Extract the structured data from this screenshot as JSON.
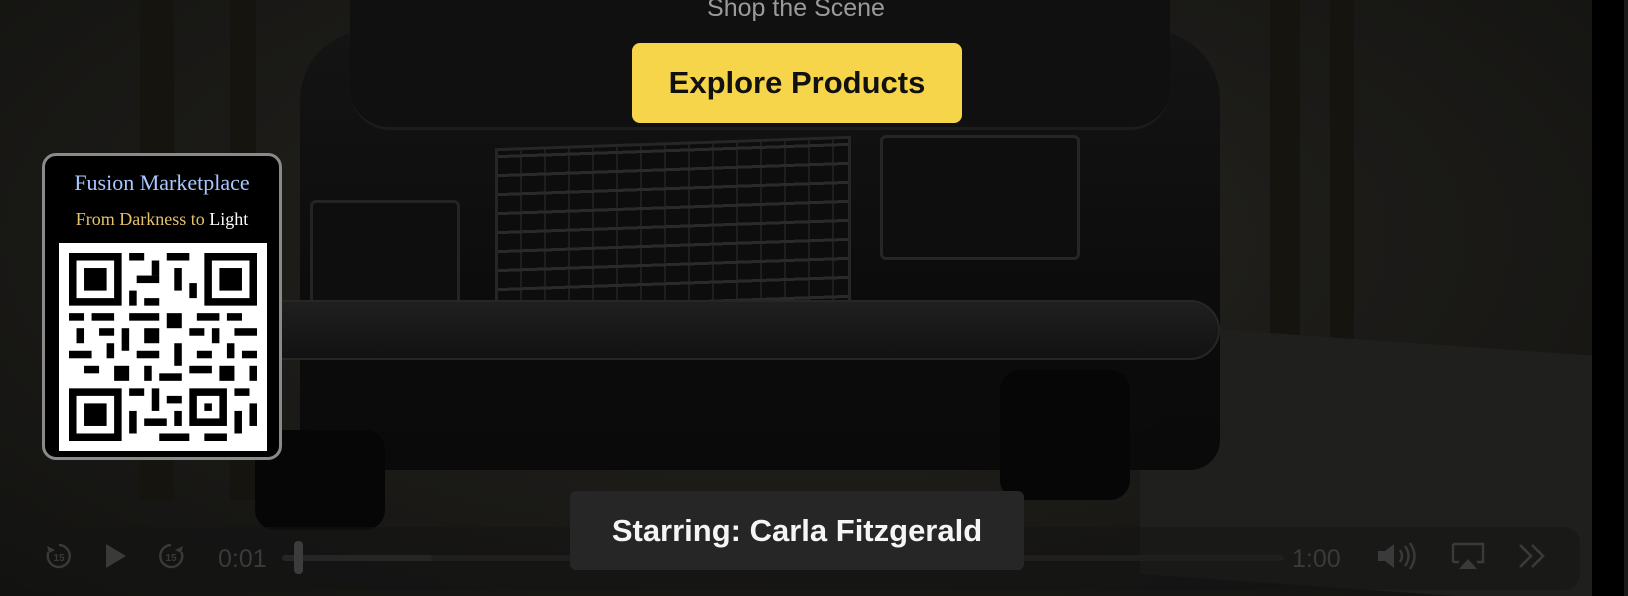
{
  "overlay": {
    "shop_label": "Shop the Scene",
    "explore_button": "Explore Products",
    "subtitle": "Starring: Carla Fitzgerald"
  },
  "qr_card": {
    "title": "Fusion Marketplace",
    "tagline_part1": "From Darkness to ",
    "tagline_part2": "Light"
  },
  "player": {
    "current_time": "0:01",
    "duration": "1:00",
    "progress": 0.017,
    "icons": [
      "rewind-15-icon",
      "play-icon",
      "forward-15-icon",
      "volume-icon",
      "airplay-icon",
      "skip-forward-icon"
    ]
  },
  "colors": {
    "button_yellow": "#f7d54a",
    "qr_title_blue": "#a9c7ff",
    "tagline_gold": "#e6c36a"
  }
}
